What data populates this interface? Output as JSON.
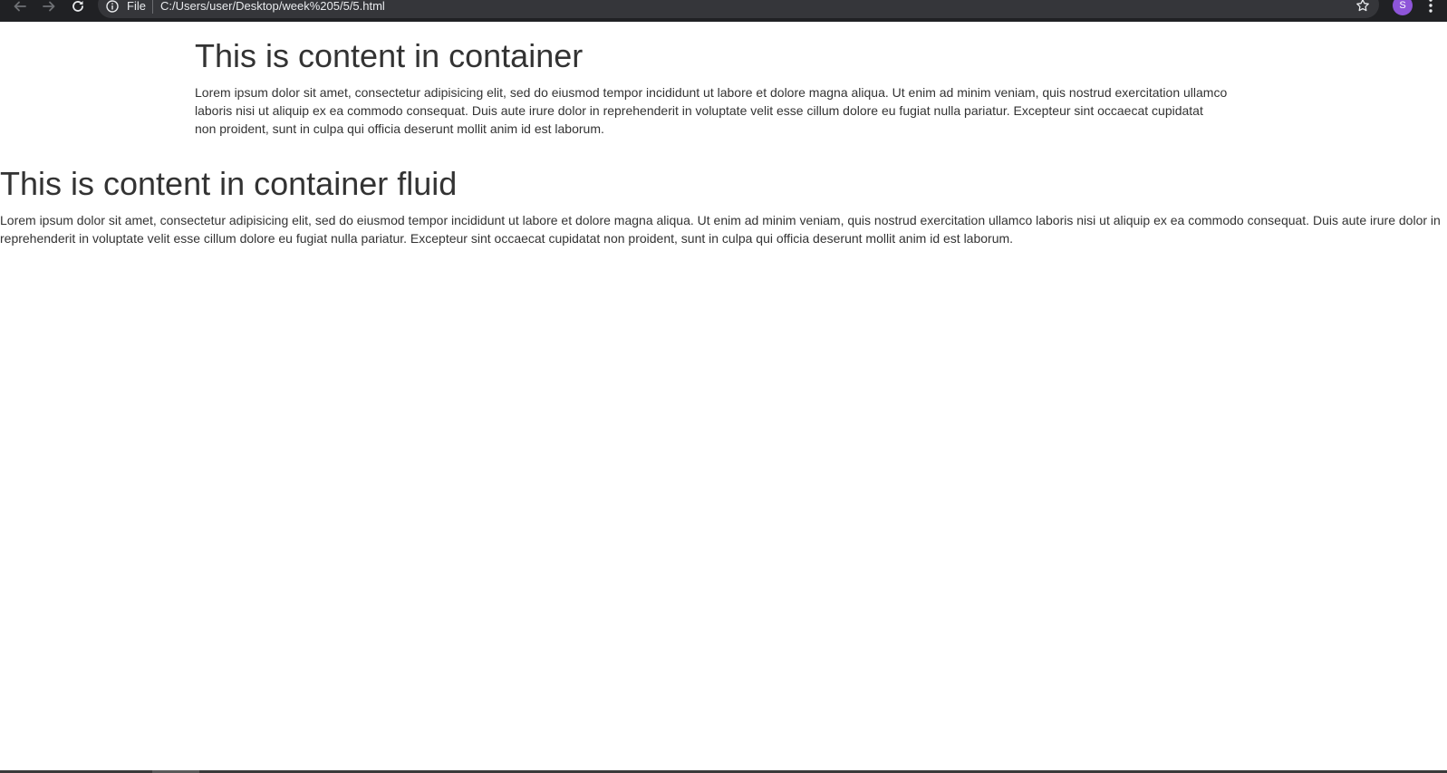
{
  "browser": {
    "omnibox": {
      "scheme_label": "File",
      "url": "C:/Users/user/Desktop/week%205/5/5.html"
    },
    "profile_initial": "S",
    "profile_color": "#8e55d9",
    "icons": {
      "back": "arrow-left-icon",
      "forward": "arrow-right-icon",
      "reload": "reload-icon",
      "info": "info-icon",
      "bookmark": "star-icon",
      "menu": "kebab-menu-icon"
    }
  },
  "content": {
    "container": {
      "heading": "This is content in container",
      "paragraph": "Lorem ipsum dolor sit amet, consectetur adipisicing elit, sed do eiusmod tempor incididunt ut labore et dolore magna aliqua. Ut enim ad minim veniam, quis nostrud exercitation ullamco laboris nisi ut aliquip ex ea commodo consequat. Duis aute irure dolor in reprehenderit in voluptate velit esse cillum dolore eu fugiat nulla pariatur. Excepteur sint occaecat cupidatat non proident, sunt in culpa qui officia deserunt mollit anim id est laborum."
    },
    "container_fluid": {
      "heading": "This is content in container fluid",
      "paragraph": "Lorem ipsum dolor sit amet, consectetur adipisicing elit, sed do eiusmod tempor incididunt ut labore et dolore magna aliqua. Ut enim ad minim veniam, quis nostrud exercitation ullamco laboris nisi ut aliquip ex ea commodo consequat. Duis aute irure dolor in reprehenderit in voluptate velit esse cillum dolore eu fugiat nulla pariatur. Excepteur sint occaecat cupidatat non proident, sunt in culpa qui officia deserunt mollit anim id est laborum."
    }
  },
  "colors": {
    "toolbar_bg": "#202124",
    "omnibox_bg": "#35363a",
    "text": "#333333"
  }
}
